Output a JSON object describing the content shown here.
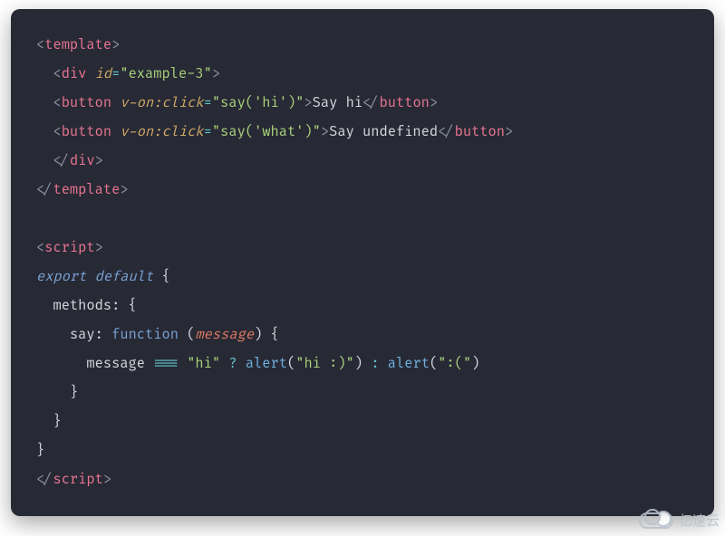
{
  "code": {
    "lines": [
      {
        "indent": 0,
        "tokens": [
          {
            "t": "<",
            "c": "pun"
          },
          {
            "t": "template",
            "c": "tag"
          },
          {
            "t": ">",
            "c": "pun"
          }
        ]
      },
      {
        "indent": 1,
        "tokens": [
          {
            "t": "<",
            "c": "pun"
          },
          {
            "t": "div",
            "c": "tag"
          },
          {
            "t": " ",
            "c": "txt"
          },
          {
            "t": "id",
            "c": "attr"
          },
          {
            "t": "=",
            "c": "op"
          },
          {
            "t": "\"example-3\"",
            "c": "str"
          },
          {
            "t": ">",
            "c": "pun"
          }
        ]
      },
      {
        "indent": 1,
        "tokens": [
          {
            "t": "<",
            "c": "pun"
          },
          {
            "t": "button",
            "c": "tag"
          },
          {
            "t": " ",
            "c": "txt"
          },
          {
            "t": "v-on:click",
            "c": "attr"
          },
          {
            "t": "=",
            "c": "op"
          },
          {
            "t": "\"say('hi')\"",
            "c": "str"
          },
          {
            "t": ">",
            "c": "pun"
          },
          {
            "t": "Say hi",
            "c": "txt"
          },
          {
            "t": "</",
            "c": "pun"
          },
          {
            "t": "button",
            "c": "tag"
          },
          {
            "t": ">",
            "c": "pun"
          }
        ]
      },
      {
        "indent": 1,
        "tokens": [
          {
            "t": "<",
            "c": "pun"
          },
          {
            "t": "button",
            "c": "tag"
          },
          {
            "t": " ",
            "c": "txt"
          },
          {
            "t": "v-on:click",
            "c": "attr"
          },
          {
            "t": "=",
            "c": "op"
          },
          {
            "t": "\"say('what')\"",
            "c": "str"
          },
          {
            "t": ">",
            "c": "pun"
          },
          {
            "t": "Say undefined",
            "c": "txt"
          },
          {
            "t": "</",
            "c": "pun"
          },
          {
            "t": "button",
            "c": "tag"
          },
          {
            "t": ">",
            "c": "pun"
          }
        ]
      },
      {
        "indent": 1,
        "tokens": [
          {
            "t": "</",
            "c": "pun"
          },
          {
            "t": "div",
            "c": "tag"
          },
          {
            "t": ">",
            "c": "pun"
          }
        ]
      },
      {
        "indent": 0,
        "tokens": [
          {
            "t": "</",
            "c": "pun"
          },
          {
            "t": "template",
            "c": "tag"
          },
          {
            "t": ">",
            "c": "pun"
          }
        ]
      },
      {
        "indent": 0,
        "tokens": []
      },
      {
        "indent": 0,
        "tokens": [
          {
            "t": "<",
            "c": "pun"
          },
          {
            "t": "script",
            "c": "tag"
          },
          {
            "t": ">",
            "c": "pun"
          }
        ]
      },
      {
        "indent": 0,
        "tokens": [
          {
            "t": "export default",
            "c": "kw"
          },
          {
            "t": " {",
            "c": "brace"
          }
        ]
      },
      {
        "indent": 1,
        "tokens": [
          {
            "t": "methods",
            "c": "key"
          },
          {
            "t": ": {",
            "c": "brace"
          }
        ]
      },
      {
        "indent": 2,
        "tokens": [
          {
            "t": "say",
            "c": "key"
          },
          {
            "t": ": ",
            "c": "brace"
          },
          {
            "t": "function",
            "c": "fn"
          },
          {
            "t": " (",
            "c": "brace"
          },
          {
            "t": "message",
            "c": "param"
          },
          {
            "t": ") {",
            "c": "brace"
          }
        ]
      },
      {
        "indent": 3,
        "tokens": [
          {
            "t": "message ",
            "c": "txt"
          },
          {
            "t": "===",
            "c": "cmp"
          },
          {
            "t": " ",
            "c": "txt"
          },
          {
            "t": "\"hi\"",
            "c": "str"
          },
          {
            "t": " ? ",
            "c": "cmp"
          },
          {
            "t": "alert",
            "c": "call"
          },
          {
            "t": "(",
            "c": "brace"
          },
          {
            "t": "\"hi :)\"",
            "c": "str"
          },
          {
            "t": ") ",
            "c": "brace"
          },
          {
            "t": ": ",
            "c": "cmp"
          },
          {
            "t": "alert",
            "c": "call"
          },
          {
            "t": "(",
            "c": "brace"
          },
          {
            "t": "\":(\"",
            "c": "str"
          },
          {
            "t": ")",
            "c": "brace"
          }
        ]
      },
      {
        "indent": 2,
        "tokens": [
          {
            "t": "}",
            "c": "brace"
          }
        ]
      },
      {
        "indent": 1,
        "tokens": [
          {
            "t": "}",
            "c": "brace"
          }
        ]
      },
      {
        "indent": 0,
        "tokens": [
          {
            "t": "}",
            "c": "brace"
          }
        ]
      },
      {
        "indent": 0,
        "tokens": [
          {
            "t": "</",
            "c": "pun"
          },
          {
            "t": "script",
            "c": "tag"
          },
          {
            "t": ">",
            "c": "pun"
          }
        ]
      }
    ],
    "indent_unit": "  "
  },
  "watermark": {
    "text": "亿速云"
  }
}
